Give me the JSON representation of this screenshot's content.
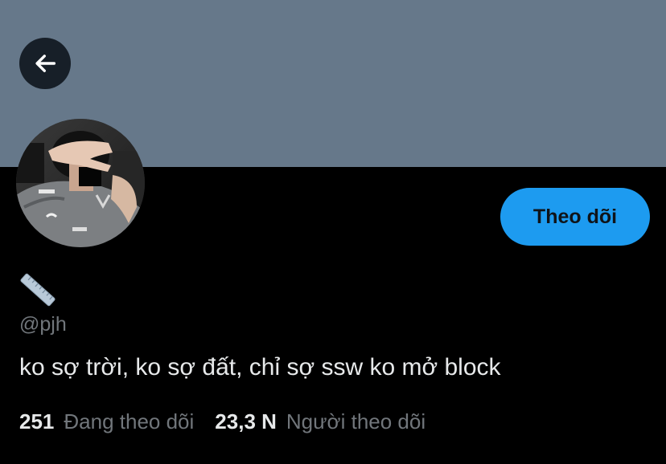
{
  "header": {
    "back_icon": "arrow-left-icon",
    "banner_color": "#66788a"
  },
  "profile": {
    "avatar_alt": "profile photo",
    "name_icon": "straight-ruler-emoji",
    "handle": "@pjh",
    "bio": "ko sợ trời, ko sợ đất, chỉ sợ ssw ko mở block",
    "follow_button_label": "Theo dõi"
  },
  "stats": {
    "following_count": "251",
    "following_label": "Đang theo dõi",
    "followers_count": "23,3 N",
    "followers_label": "Người theo dõi"
  },
  "colors": {
    "accent": "#1d9bf0",
    "background": "#000000",
    "secondary_text": "#71767b",
    "primary_text": "#e7e9ea"
  }
}
